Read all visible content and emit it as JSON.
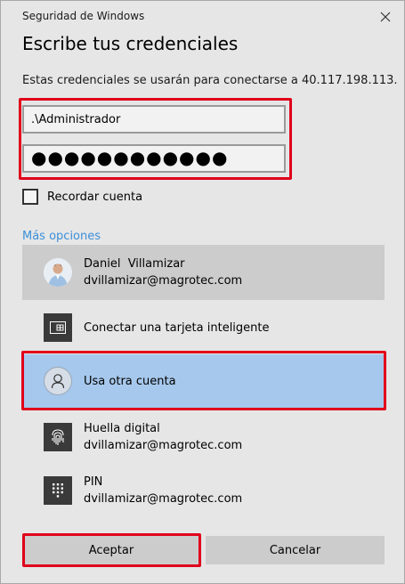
{
  "window": {
    "title": "Seguridad de Windows",
    "close_icon": "close-icon"
  },
  "heading": "Escribe tus credenciales",
  "subtitle": "Estas credenciales se usarán para conectarse a 40.117.198.113.",
  "username": {
    "value": ".\\Administrador"
  },
  "password": {
    "masked_value": "●●●●●●●●●●●●"
  },
  "remember": {
    "label": "Recordar cuenta",
    "checked": false
  },
  "more_options": "Más opciones",
  "options": [
    {
      "line1": "Daniel  Villamizar",
      "line2": "dvillamizar@magrotec.com",
      "icon": "user-avatar",
      "selected": "gray"
    },
    {
      "line1": "Conectar una tarjeta inteligente",
      "icon": "smart-card-icon"
    },
    {
      "line1": "Usa otra cuenta",
      "icon": "person-icon",
      "selected": "blue"
    },
    {
      "line1": "Huella digital",
      "line2": "dvillamizar@magrotec.com",
      "icon": "fingerprint-icon"
    },
    {
      "line1": "PIN",
      "line2": "dvillamizar@magrotec.com",
      "icon": "pin-keypad-icon"
    }
  ],
  "buttons": {
    "accept": "Aceptar",
    "cancel": "Cancelar"
  },
  "colors": {
    "highlight_red": "#e0001b",
    "link_blue": "#3b8fd9",
    "selected_blue": "#a6c8ec",
    "selected_gray": "#cccccc",
    "dialog_bg": "#e6e6e6"
  }
}
